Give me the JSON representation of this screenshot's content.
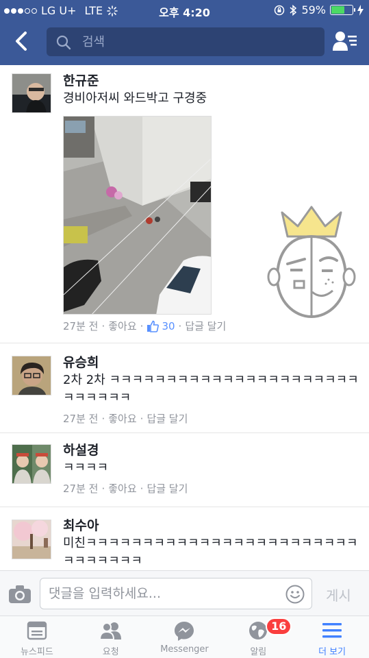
{
  "status_bar": {
    "carrier": "LG U+",
    "network": "LTE",
    "time": "오후 4:20",
    "battery": "59%",
    "battery_level": 0.59
  },
  "nav": {
    "search_placeholder": "검색"
  },
  "comments": [
    {
      "name": "한규준",
      "text": "경비아저씨 와드박고 구경중",
      "time": "27분 전",
      "like_label": "좋아요",
      "like_count": "30",
      "reply_label": "답글 달기"
    },
    {
      "name": "유승희",
      "text": "2차 2차 ㅋㅋㅋㅋㅋㅋㅋㅋㅋㅋㅋㅋㅋㅋㅋㅋㅋㅋㅋㅋㅋㅋㅋㅋㅋㅋㅋㅋ",
      "time": "27분 전",
      "like_label": "좋아요",
      "reply_label": "답글 달기"
    },
    {
      "name": "하설경",
      "text": "ㅋㅋㅋㅋ",
      "time": "27분 전",
      "like_label": "좋아요",
      "reply_label": "답글 달기"
    },
    {
      "name": "최수아",
      "text": "미친ㅋㅋㅋㅋㅋㅋㅋㅋㅋㅋㅋㅋㅋㅋㅋㅋㅋㅋㅋㅋㅋㅋㅋㅋㅋㅋㅋㅋㅋㅋㅋ"
    }
  ],
  "composer": {
    "placeholder": "댓글을 입력하세요...",
    "post_label": "게시"
  },
  "tabs": [
    {
      "label": "뉴스피드",
      "icon": "news-feed-icon"
    },
    {
      "label": "요청",
      "icon": "friend-requests-icon"
    },
    {
      "label": "Messenger",
      "icon": "messenger-icon"
    },
    {
      "label": "알림",
      "icon": "globe-icon",
      "badge": "16"
    },
    {
      "label": "더 보기",
      "icon": "menu-icon",
      "active": true
    }
  ],
  "colors": {
    "header": "#3b5998",
    "accent": "#4080ff",
    "badge": "#fa3e3e"
  }
}
